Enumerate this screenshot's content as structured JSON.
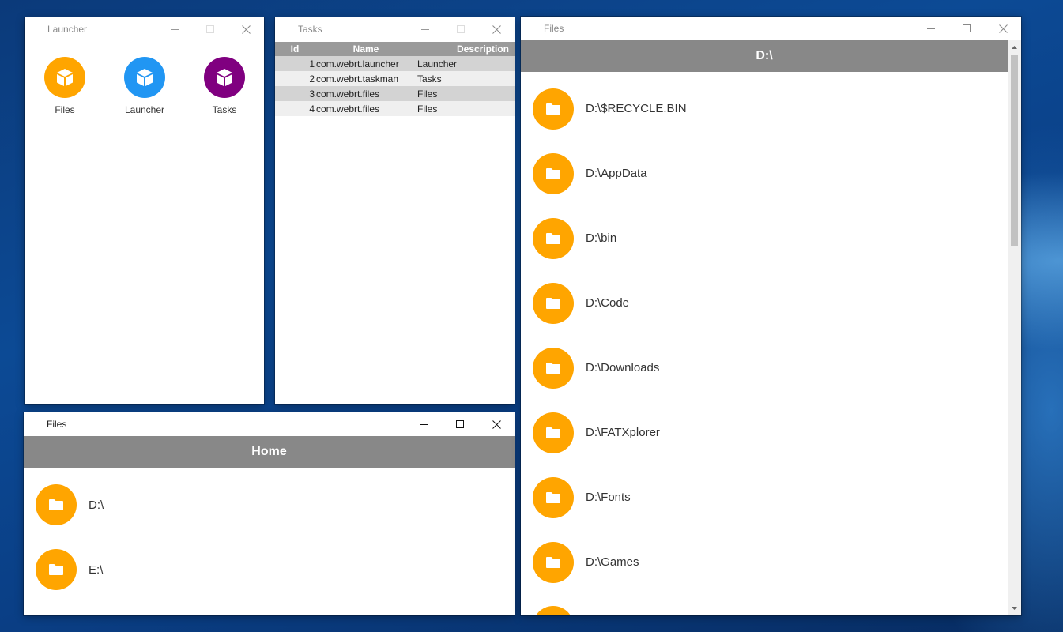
{
  "colors": {
    "folder": "#FFA500",
    "files_app": "#FFA500",
    "launcher_app": "#2196F3",
    "tasks_app": "#800080",
    "header_bg": "#888888"
  },
  "launcher": {
    "title": "Launcher",
    "apps": [
      {
        "label": "Files",
        "icon": "cube-icon",
        "color": "#FFA500"
      },
      {
        "label": "Launcher",
        "icon": "cube-icon",
        "color": "#2196F3"
      },
      {
        "label": "Tasks",
        "icon": "cube-icon",
        "color": "#800080"
      }
    ]
  },
  "tasks": {
    "title": "Tasks",
    "columns": [
      "Id",
      "Name",
      "Description"
    ],
    "rows": [
      {
        "id": "1",
        "name": "com.webrt.launcher",
        "description": "Launcher"
      },
      {
        "id": "2",
        "name": "com.webrt.taskman",
        "description": "Tasks"
      },
      {
        "id": "3",
        "name": "com.webrt.files",
        "description": "Files"
      },
      {
        "id": "4",
        "name": "com.webrt.files",
        "description": "Files"
      }
    ]
  },
  "files_home": {
    "title": "Files",
    "header": "Home",
    "items": [
      "D:\\",
      "E:\\"
    ]
  },
  "files_d": {
    "title": "Files",
    "header": "D:\\",
    "items": [
      "D:\\$RECYCLE.BIN",
      "D:\\AppData",
      "D:\\bin",
      "D:\\Code",
      "D:\\Downloads",
      "D:\\FATXplorer",
      "D:\\Fonts",
      "D:\\Games"
    ]
  }
}
